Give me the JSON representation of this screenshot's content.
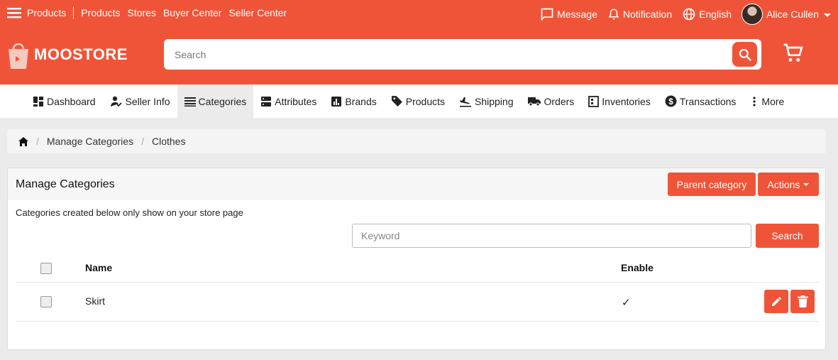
{
  "topbar": {
    "left_links": [
      "Products",
      "Products",
      "Stores",
      "Buyer Center",
      "Seller Center"
    ],
    "message": "Message",
    "notification": "Notification",
    "language": "English",
    "user": "Alice Cullen"
  },
  "header": {
    "brand": "MOOSTORE",
    "search_placeholder": "Search"
  },
  "nav": {
    "tabs": [
      {
        "label": "Dashboard",
        "icon": "dashboard-icon"
      },
      {
        "label": "Seller Info",
        "icon": "seller-icon"
      },
      {
        "label": "Categories",
        "icon": "list-icon"
      },
      {
        "label": "Attributes",
        "icon": "attributes-icon"
      },
      {
        "label": "Brands",
        "icon": "chart-icon"
      },
      {
        "label": "Products",
        "icon": "tag-icon"
      },
      {
        "label": "Shipping",
        "icon": "plane-icon"
      },
      {
        "label": "Orders",
        "icon": "truck-icon"
      },
      {
        "label": "Inventories",
        "icon": "inventory-icon"
      },
      {
        "label": "Transactions",
        "icon": "dollar-icon"
      },
      {
        "label": "More",
        "icon": "more-icon"
      }
    ],
    "active": "Categories"
  },
  "breadcrumb": {
    "items": [
      "Manage Categories",
      "Clothes"
    ]
  },
  "panel": {
    "title": "Manage Categories",
    "parent_button": "Parent category",
    "actions_button": "Actions",
    "note": "Categories created below only show on your store page",
    "keyword_placeholder": "Keyword",
    "search_button": "Search",
    "columns": {
      "name": "Name",
      "enable": "Enable"
    },
    "rows": [
      {
        "name": "Skirt",
        "enabled": "✓"
      }
    ]
  },
  "colors": {
    "brand": "#f05438"
  }
}
